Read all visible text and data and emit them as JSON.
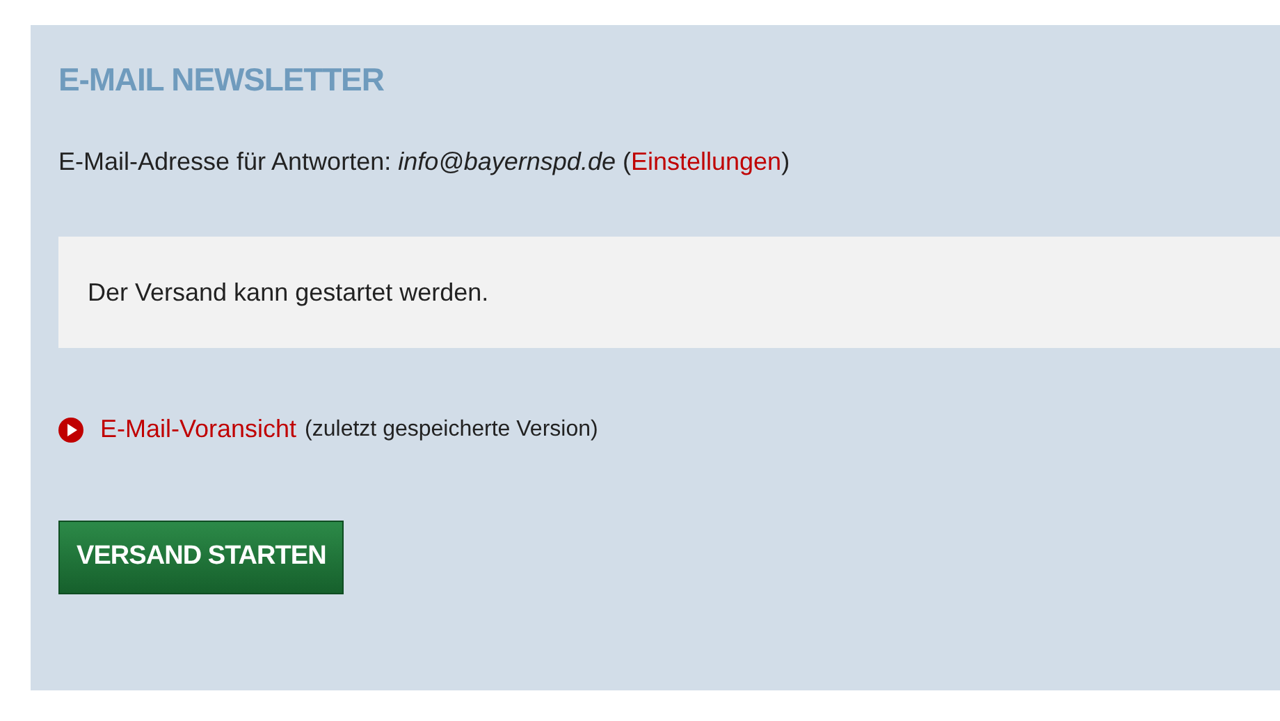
{
  "panel": {
    "title": "E-MAIL NEWSLETTER",
    "reply_address": {
      "text_before": "E-Mail-Adresse für Antworten: *info@bayernspd.de* (",
      "link": "Einstellungen",
      "text_after": ")"
    },
    "status_message": "Der Versand kann gestartet werden.",
    "preview": {
      "link": "E-Mail-Voransicht",
      "note": "(zuletzt gespeicherte Version)"
    },
    "button": "VERSAND STARTEN"
  }
}
